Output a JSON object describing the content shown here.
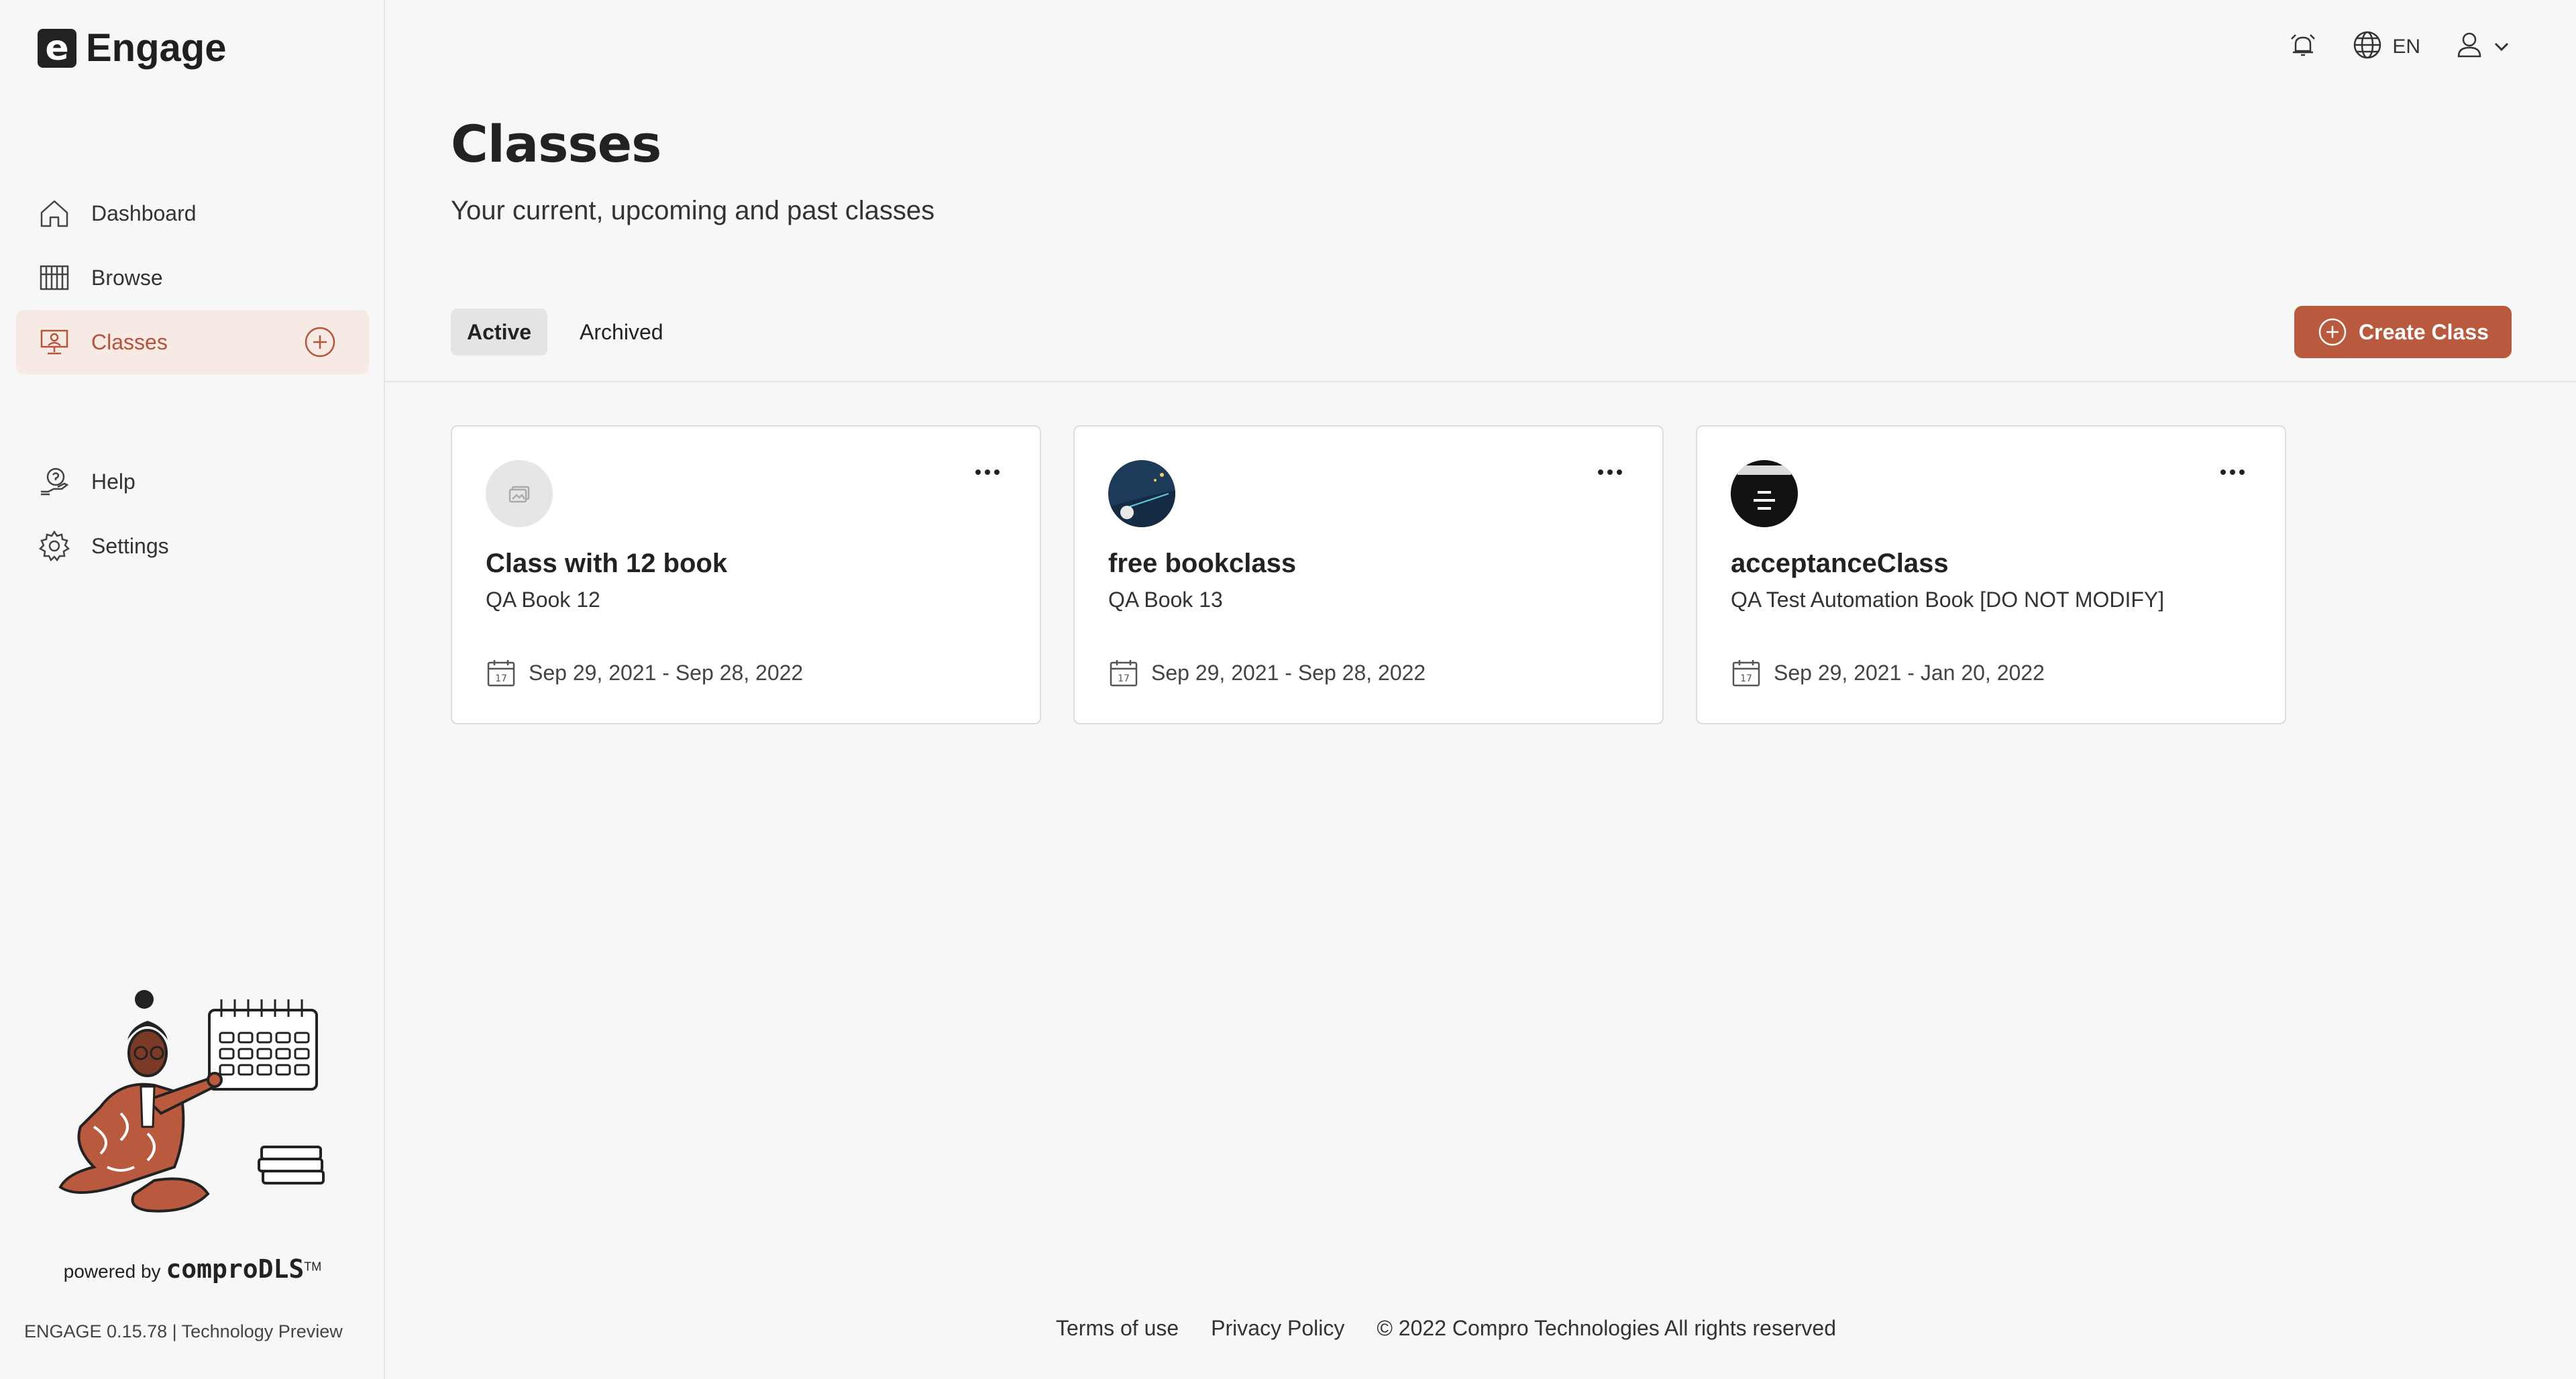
{
  "app": {
    "name": "Engage",
    "logo_letter": "e"
  },
  "header": {
    "language": "EN"
  },
  "sidebar": {
    "items": [
      {
        "label": "Dashboard",
        "icon": "home-icon"
      },
      {
        "label": "Browse",
        "icon": "library-icon"
      },
      {
        "label": "Classes",
        "icon": "classroom-icon",
        "active": true
      },
      {
        "label": "Help",
        "icon": "help-icon"
      },
      {
        "label": "Settings",
        "icon": "gear-icon"
      }
    ],
    "powered_by": "powered by",
    "powered_brand": "comproDLS",
    "trademark": "TM",
    "version": "ENGAGE 0.15.78 | Technology Preview"
  },
  "main": {
    "title": "Classes",
    "subtitle": "Your current, upcoming and past classes",
    "tabs": [
      {
        "label": "Active",
        "selected": true
      },
      {
        "label": "Archived"
      }
    ],
    "create_button": "Create Class",
    "cards": [
      {
        "title": "Class with 12 book",
        "book": "QA Book 12",
        "dates": "Sep 29, 2021 - Sep 28, 2022",
        "avatar": "placeholder-image-icon"
      },
      {
        "title": "free bookclass",
        "book": "QA Book 13",
        "dates": "Sep 29, 2021 - Sep 28, 2022",
        "avatar": "book-cover-thumbnail"
      },
      {
        "title": "acceptanceClass",
        "book": "QA Test Automation Book [DO NOT MODIFY]",
        "dates": "Sep 29, 2021 - Jan 20, 2022",
        "avatar": "book-cover-thumbnail"
      }
    ]
  },
  "footer": {
    "terms": "Terms of use",
    "privacy": "Privacy Policy",
    "copyright": "© 2022 Compro Technologies All rights reserved"
  },
  "colors": {
    "accent": "#b95a3e",
    "active_bg": "#f7e9e4",
    "background": "#f7f7f7"
  }
}
